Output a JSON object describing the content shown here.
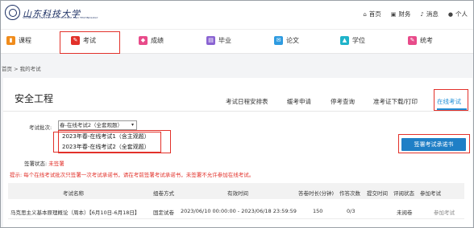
{
  "header": {
    "logo_title": "山东科技大学",
    "logo_subtitle": "SHANDONG UNIVERSITY OF SCIENCE AND TECHNOLOGY",
    "links": [
      {
        "icon": "home-icon",
        "glyph": "⌂",
        "label": "首页"
      },
      {
        "icon": "finance-icon",
        "glyph": "▣",
        "label": "财务"
      },
      {
        "icon": "bell-icon",
        "glyph": "♪",
        "label": "消息"
      },
      {
        "icon": "user-icon",
        "glyph": "●",
        "label": "个人"
      }
    ]
  },
  "nav": {
    "items": [
      {
        "label": "课程",
        "icon": "course-icon",
        "color": "#f08c1c"
      },
      {
        "label": "考试",
        "icon": "exam-icon",
        "color": "#e2312a"
      },
      {
        "label": "成绩",
        "icon": "grade-icon",
        "color": "#e84b8a"
      },
      {
        "label": "毕业",
        "icon": "graduation-icon",
        "color": "#8a63d2"
      },
      {
        "label": "论文",
        "icon": "thesis-icon",
        "color": "#2e9be0"
      },
      {
        "label": "学位",
        "icon": "degree-icon",
        "color": "#1fb3c9"
      },
      {
        "label": "统考",
        "icon": "unified-exam-icon",
        "color": "#e84b8a"
      }
    ]
  },
  "breadcrumb": "首页 > 我的考试",
  "page_title": "安全工程",
  "tabs": [
    {
      "label": "考试日程安排表",
      "active": false
    },
    {
      "label": "缓考申请",
      "active": false
    },
    {
      "label": "停考查询",
      "active": false
    },
    {
      "label": "准考证下载/打印",
      "active": false
    },
    {
      "label": "在线考试",
      "active": true
    }
  ],
  "batch": {
    "label": "考试批次:",
    "selected": "春-在线考试2（全套观题）",
    "options": [
      "2023年春-在线考试1（含主观题）",
      "2023年春-在线考试2（全套观题）"
    ]
  },
  "sign_status": {
    "label": "签署状态:",
    "value": "未签署"
  },
  "tip": "提示: 每个在线考试批次只签署一次考试承诺书，请在考前签署考试承诺书，未签署不允许参加在线考试。",
  "sign_button": "签署考试承诺书",
  "table": {
    "columns": [
      "考试名称",
      "组卷方式",
      "有效时间",
      "答卷时长(分钟)",
      "作答次数",
      "提交时间",
      "评阅状态",
      "参加考试"
    ],
    "rows": [
      {
        "name": "马克思主义基本原理概论（周本）【6月10日-6月18日】",
        "method": "固定试卷",
        "valid_time": "2023/06/10 00:00:00 - 2023/06/18 23:59:59",
        "duration": "150",
        "attempts": "0/3",
        "submit_time": "",
        "review_status": "未阅卷",
        "action": "参加考试"
      }
    ]
  },
  "colors": {
    "accent": "#1f8fd7",
    "highlight": "#e2312a",
    "button": "#1f7fc6"
  }
}
